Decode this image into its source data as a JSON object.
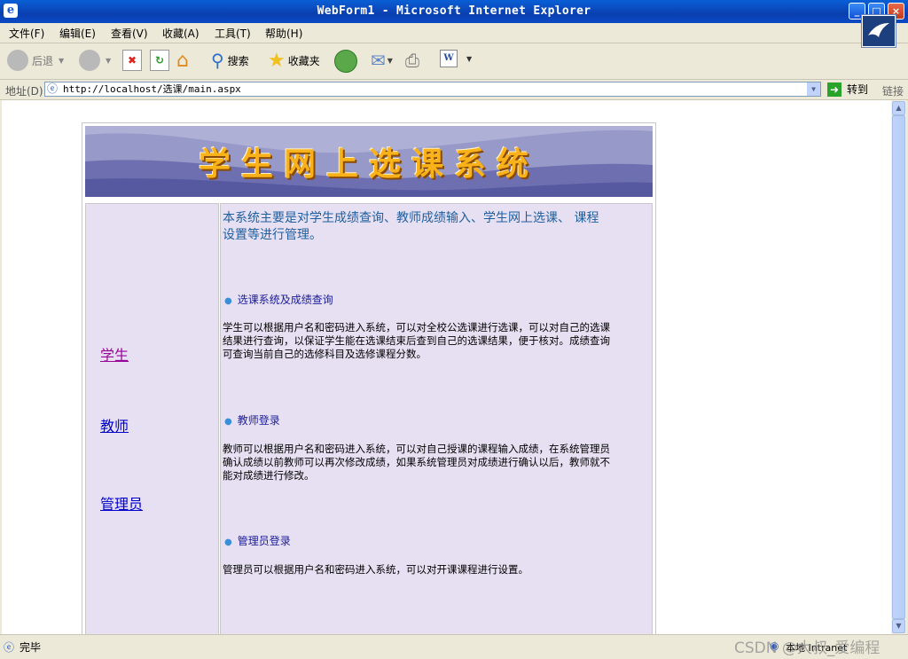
{
  "window": {
    "title": "WebForm1 - Microsoft Internet Explorer"
  },
  "menu": [
    "文件(F)",
    "编辑(E)",
    "查看(V)",
    "收藏(A)",
    "工具(T)",
    "帮助(H)"
  ],
  "toolbar": {
    "back": "后退",
    "search": "搜索",
    "favorites": "收藏夹"
  },
  "address": {
    "label": "地址(D)",
    "url": "http://localhost/选课/main.aspx",
    "go": "转到",
    "links": "链接"
  },
  "page": {
    "banner_title": "学生网上选课系统",
    "nav": [
      "学生",
      "教师",
      "管理员"
    ],
    "intro": "本系统主要是对学生成绩查询、教师成绩输入、学生网上选课、 课程设置等进行管理。",
    "sections": [
      {
        "title": "选课系统及成绩查询",
        "body": "学生可以根据用户名和密码进入系统，可以对全校公选课进行选课，可以对自己的选课结果进行查询，以保证学生能在选课结束后查到自己的选课结果，便于核对。成绩查询可查询当前自己的选修科目及选修课程分数。"
      },
      {
        "title": "教师登录",
        "body": " 教师可以根据用户名和密码进入系统，可以对自己授课的课程输入成绩，在系统管理员确认成绩以前教师可以再次修改成绩，如果系统管理员对成绩进行确认以后，教师就不能对成绩进行修改。"
      },
      {
        "title": "管理员登录",
        "body": "管理员可以根据用户名和密码进入系统，可以对开课课程进行设置。"
      }
    ]
  },
  "status": {
    "text": "完毕",
    "zone": "本地 Intranet",
    "watermark": "CSDN @大叔_爱编程"
  },
  "colors": {
    "link": "#0000cc",
    "visited": "#990099",
    "content_bg": "#e6e0f2",
    "banner_text": "#f9b21a"
  }
}
